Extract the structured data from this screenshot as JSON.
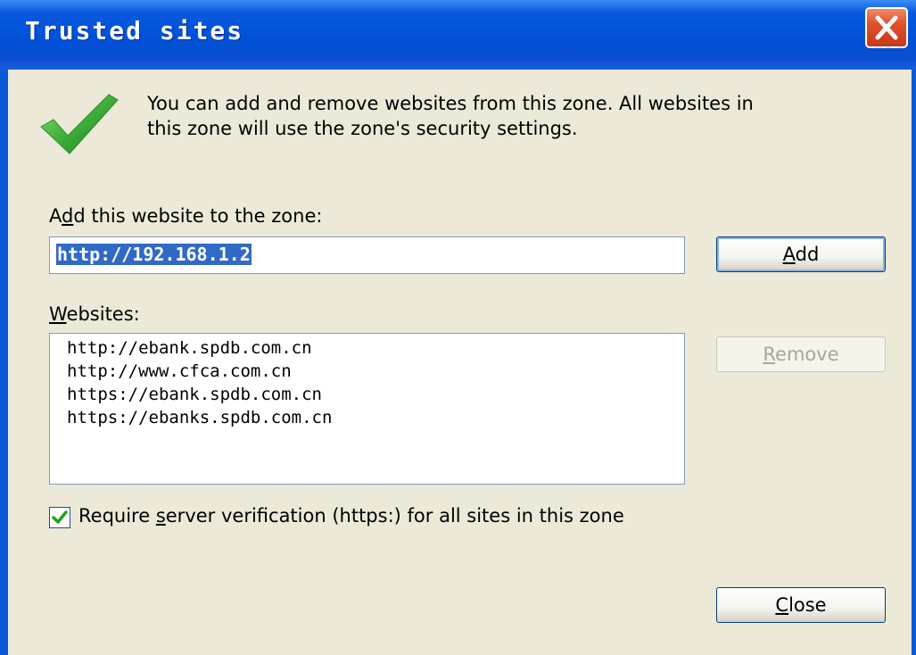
{
  "window": {
    "title": "Trusted sites",
    "colors": {
      "title_bar": "#0a5ad8",
      "client_bg": "#ece9d8",
      "selection": "#316ac5"
    }
  },
  "intro": {
    "line1": "You can add and remove websites from this zone. All websites in",
    "line2": "this zone will use the zone's security settings.",
    "icon": "checkmark-icon"
  },
  "add_section": {
    "label_a": "A",
    "label_d": "d",
    "label_rest": "d this website to the zone:",
    "input_value": "http://192.168.1.2",
    "add_button": {
      "u": "A",
      "rest": "dd"
    }
  },
  "websites": {
    "label_u": "W",
    "label_rest": "ebsites:",
    "items": [
      "http://ebank.spdb.com.cn",
      "http://www.cfca.com.cn",
      "https://ebank.spdb.com.cn",
      "https://ebanks.spdb.com.cn"
    ],
    "remove_button": {
      "u": "R",
      "rest": "emove"
    }
  },
  "verification": {
    "checked": true,
    "label_pre": "Require ",
    "label_u": "s",
    "label_rest": "erver verification (https:) for all sites in this zone"
  },
  "close_button": {
    "u": "C",
    "rest": "lose"
  }
}
